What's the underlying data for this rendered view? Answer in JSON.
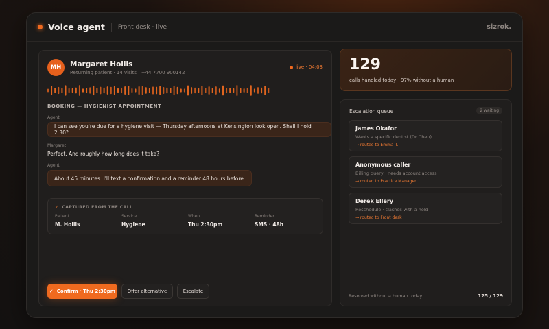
{
  "header": {
    "title": "Voice agent",
    "subtitle": "Front desk · live",
    "brand": "sizrok."
  },
  "caller": {
    "initials": "MH",
    "name": "Margaret Hollis",
    "meta": "Returning patient · 14 visits · +44 7700 900142",
    "live": "live · 04:03"
  },
  "booking_label": "BOOKING — HYGIENIST APPOINTMENT",
  "transcript": [
    {
      "speaker": "Agent",
      "text": "I can see you're due for a hygiene visit — Thursday afternoons at Kensington look open. Shall I hold 2:30?"
    },
    {
      "speaker": "Margaret",
      "text": "Perfect. And roughly how long does it take?"
    },
    {
      "speaker": "Agent",
      "text": "About 45 minutes. I'll text a confirmation and a reminder 48 hours before."
    }
  ],
  "captured": {
    "heading": "CAPTURED FROM THE CALL",
    "fields": [
      {
        "label": "Patient",
        "value": "M. Hollis"
      },
      {
        "label": "Service",
        "value": "Hygiene"
      },
      {
        "label": "When",
        "value": "Thu 2:30pm"
      },
      {
        "label": "Reminder",
        "value": "SMS · 48h"
      }
    ]
  },
  "actions": {
    "confirm": "Confirm · Thu 2:30pm",
    "offer": "Offer alternative",
    "escalate": "Escalate"
  },
  "stats": {
    "number": "129",
    "caption": "calls handled today · 97% without a human"
  },
  "queue": {
    "title": "Escalation queue",
    "badge": "2 waiting",
    "items": [
      {
        "name": "James Okafor",
        "desc": "Wants a specific dentist (Dr Chen)",
        "route": "→ routed to Emma T."
      },
      {
        "name": "Anonymous caller",
        "desc": "Billing query · needs account access",
        "route": "→ routed to Practice Manager"
      },
      {
        "name": "Derek Ellery",
        "desc": "Reschedule · clashes with a hold",
        "route": "→ routed to Front desk"
      }
    ],
    "footer_label": "Resolved without a human today",
    "footer_value": "125 / 129"
  },
  "colors": {
    "accent": "#f06a1f",
    "background": "#1b1a19"
  }
}
